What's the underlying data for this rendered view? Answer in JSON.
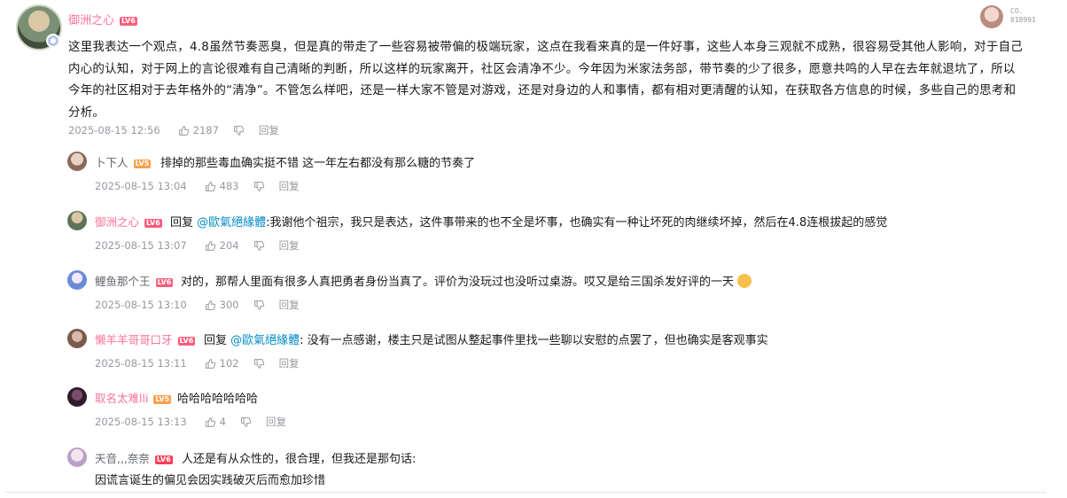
{
  "main": {
    "username": "御洲之心",
    "level": "LV6",
    "text": "这里我表达一个观点，4.8虽然节奏恶臭，但是真的带走了一些容易被带偏的极端玩家，这点在我看来真的是一件好事，这些人本身三观就不成熟，很容易受其他人影响，对于自己内心的认知，对于网上的言论很难有自己清晰的判断，所以这样的玩家离开，社区会清净不少。今年因为米家法务部，带节奏的少了很多，愿意共鸣的人早在去年就退坑了，所以今年的社区相对于去年格外的“清净”。不管怎么样吧，还是一样大家不管是对游戏，还是对身边的人和事情，都有相对更清醒的认知，在获取各方信息的时候，多些自己的思考和分析。",
    "time": "2025-08-15 12:56",
    "likes": "2187",
    "reply_label": "回复"
  },
  "corner": {
    "line1": "CO.",
    "line2": "018991"
  },
  "replies": [
    {
      "username": "卜下人",
      "level": "LV5",
      "prefix": "",
      "at": "",
      "text": "排掉的那些毒血确实挺不错 这一年左右都没有那么糖的节奏了",
      "time": "2025-08-15 13:04",
      "likes": "483",
      "reply_label": "回复"
    },
    {
      "username": "御洲之心",
      "level": "LV6",
      "prefix": "回复",
      "at": "@歐氣絕緣體",
      "text": ":我谢他个祖宗，我只是表达，这件事带来的也不全是坏事，也确实有一种让坏死的肉继续坏掉，然后在4.8连根拔起的感觉",
      "time": "2025-08-15 13:07",
      "likes": "204",
      "reply_label": "回复"
    },
    {
      "username": "鲤鱼那个王",
      "level": "LV6",
      "prefix": "",
      "at": "",
      "text": "对的，那帮人里面有很多人真把勇者身份当真了。评价为没玩过也没听过桌游。哎又是给三国杀发好评的一天",
      "time": "2025-08-15 13:10",
      "likes": "300",
      "reply_label": "回复"
    },
    {
      "username": "懒羊羊哥哥口牙",
      "level": "LV6",
      "prefix": "回复",
      "at": "@歐氣絕緣體",
      "text": ": 没有一点感谢，楼主只是试图从整起事件里找一些聊以安慰的点罢了，但也确实是客观事实",
      "time": "2025-08-15 13:11",
      "likes": "102",
      "reply_label": "回复"
    },
    {
      "username": "取名太难lli",
      "level": "LV5",
      "prefix": "",
      "at": "",
      "text": "哈哈哈哈哈哈哈",
      "time": "2025-08-15 13:13",
      "likes": "4",
      "reply_label": "回复"
    },
    {
      "username": "天音,,,奈奈",
      "level": "LV6",
      "prefix": "",
      "at": "",
      "text": "人还是有从众性的，很合理，但我还是那句话:",
      "text2": "因谎言诞生的偏见会因实践破灭后而愈加珍惜",
      "time": "",
      "likes": "",
      "reply_label": ""
    }
  ],
  "icons": {
    "like": "thumbs-up-icon",
    "dislike": "thumbs-down-icon",
    "emoji": "cat-emoji-icon"
  }
}
